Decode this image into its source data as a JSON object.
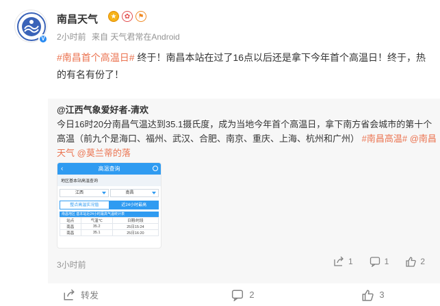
{
  "user": {
    "name": "南昌天气",
    "time": "2小时前",
    "source": "来自 天气君常在Android"
  },
  "post": {
    "topic": "#南昌首个高温日#",
    "text": " 终于！南昌本站在过了16点以后还是拿下今年首个高温日！终于，热的有名有份了！"
  },
  "repost": {
    "author": "@江西气象爱好者-清欢",
    "text": "今日16时20分南昌气温达到35.1摄氏度，成为当地今年首个高温日，拿下南方省会城市的第十个高温（前九个是海口、福州、武汉、合肥、南京、重庆、上海、杭州和广州）",
    "topic": "#南昌高温#",
    "mention1": "@南昌天气",
    "mention2": "@莫兰蒂的落",
    "time": "3小时前",
    "share_count": "1",
    "comment_count": "1",
    "like_count": "2",
    "thumbnail": {
      "header": "高温查询",
      "subtitle": "地区基本站高温查询",
      "province": "江西",
      "city": "南昌",
      "tab_active": "整点高温实况值",
      "tab_other": "近24小时最高",
      "band": "南昌地区 基本站近24小时最高气温统计表",
      "table_header": [
        "站点",
        "气温℃",
        "日期/时段"
      ],
      "rows": [
        [
          "南昌",
          "35.2",
          "25日15:24"
        ],
        [
          "南昌",
          "35.1",
          "25日16:20"
        ]
      ]
    }
  },
  "actions": {
    "repost_label": "转发",
    "comment_count": "2",
    "like_count": "3"
  },
  "colors": {
    "accent": "#eb7350",
    "verified": "#2a8bf2",
    "repost_bg": "#f7f7f7"
  }
}
